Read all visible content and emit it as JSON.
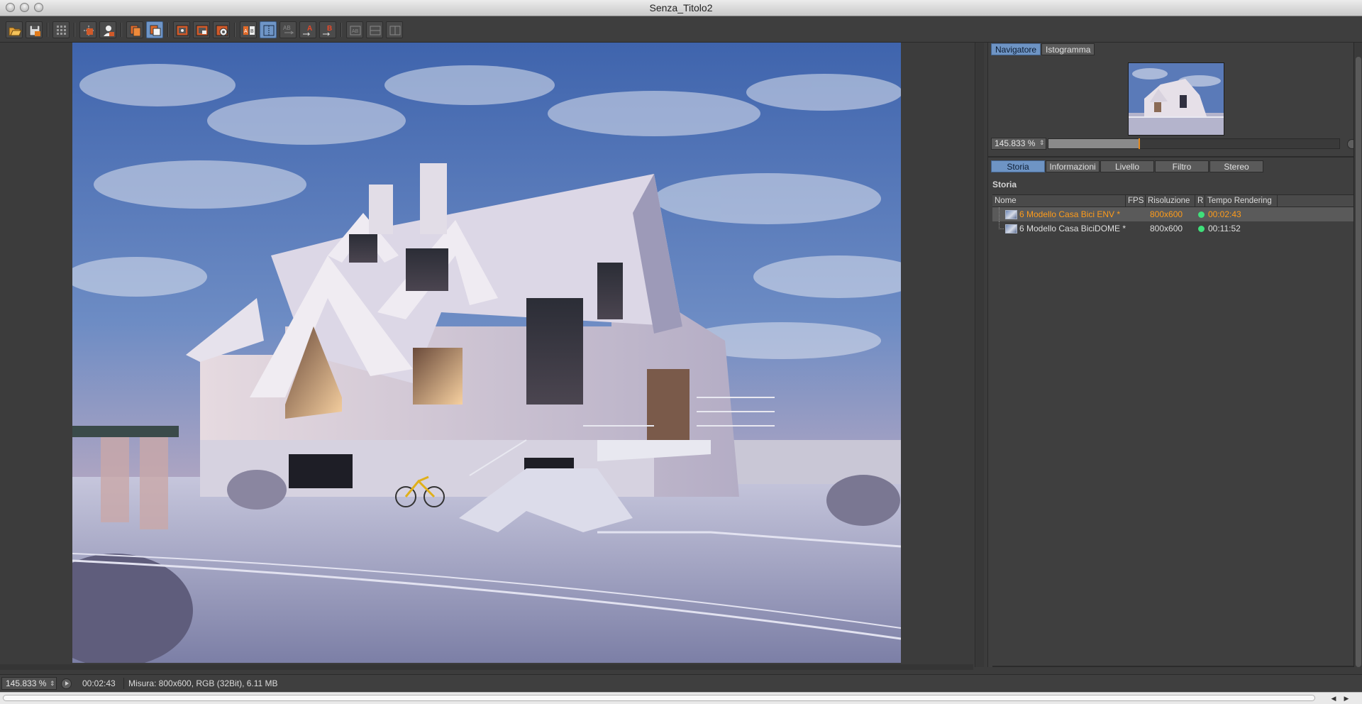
{
  "window": {
    "title": "Senza_Titolo2"
  },
  "toolbar": {
    "buttons": [
      {
        "name": "open-icon",
        "active": false
      },
      {
        "name": "save-icon",
        "active": false
      },
      {
        "name": "grid-icon",
        "active": false
      },
      {
        "name": "region-icon",
        "active": false
      },
      {
        "name": "person-icon",
        "active": false
      },
      {
        "name": "copy-icon",
        "active": false
      },
      {
        "name": "layers-icon",
        "active": true
      },
      {
        "name": "render-view-icon",
        "active": false
      },
      {
        "name": "render-region-icon",
        "active": false
      },
      {
        "name": "render-settings-icon",
        "active": false
      },
      {
        "name": "compare-ab-icon",
        "active": false
      },
      {
        "name": "split-view-icon",
        "active": true
      },
      {
        "name": "swap-ab-icon",
        "active": false
      },
      {
        "name": "set-a-icon",
        "active": false
      },
      {
        "name": "set-b-icon",
        "active": false
      },
      {
        "name": "fit-icon",
        "active": false
      },
      {
        "name": "split-horizontal-icon",
        "active": false
      },
      {
        "name": "split-vertical-icon",
        "active": false
      }
    ]
  },
  "navigator": {
    "tabs": [
      "Navigatore",
      "Istogramma"
    ],
    "active_tab": "Navigatore",
    "zoom": "145.833 %",
    "zoom_fraction": 0.31
  },
  "history": {
    "tabs": [
      "Storia",
      "Informazioni",
      "Livello",
      "Filtro",
      "Stereo"
    ],
    "active_tab": "Storia",
    "title": "Storia",
    "columns": [
      "Nome",
      "FPS",
      "Risoluzione",
      "R",
      "Tempo Rendering"
    ],
    "rows": [
      {
        "name": "6 Modello Casa Bici ENV *",
        "fps": "",
        "resolution": "800x600",
        "time": "00:02:43",
        "selected": true,
        "status_color": "#3fe07a"
      },
      {
        "name": "6 Modello Casa BiciDOME *",
        "fps": "",
        "resolution": "800x600",
        "time": "00:11:52",
        "selected": false,
        "status_color": "#3fe07a"
      }
    ],
    "selected_text_color": "#ff9c1a"
  },
  "status": {
    "zoom": "145.833 %",
    "time": "00:02:43",
    "info": "Misura: 800x600, RGB (32Bit), 6.11 MB"
  },
  "colors": {
    "accent": "#6e94c4",
    "highlight": "#e58a1f",
    "ok": "#3fe07a"
  }
}
